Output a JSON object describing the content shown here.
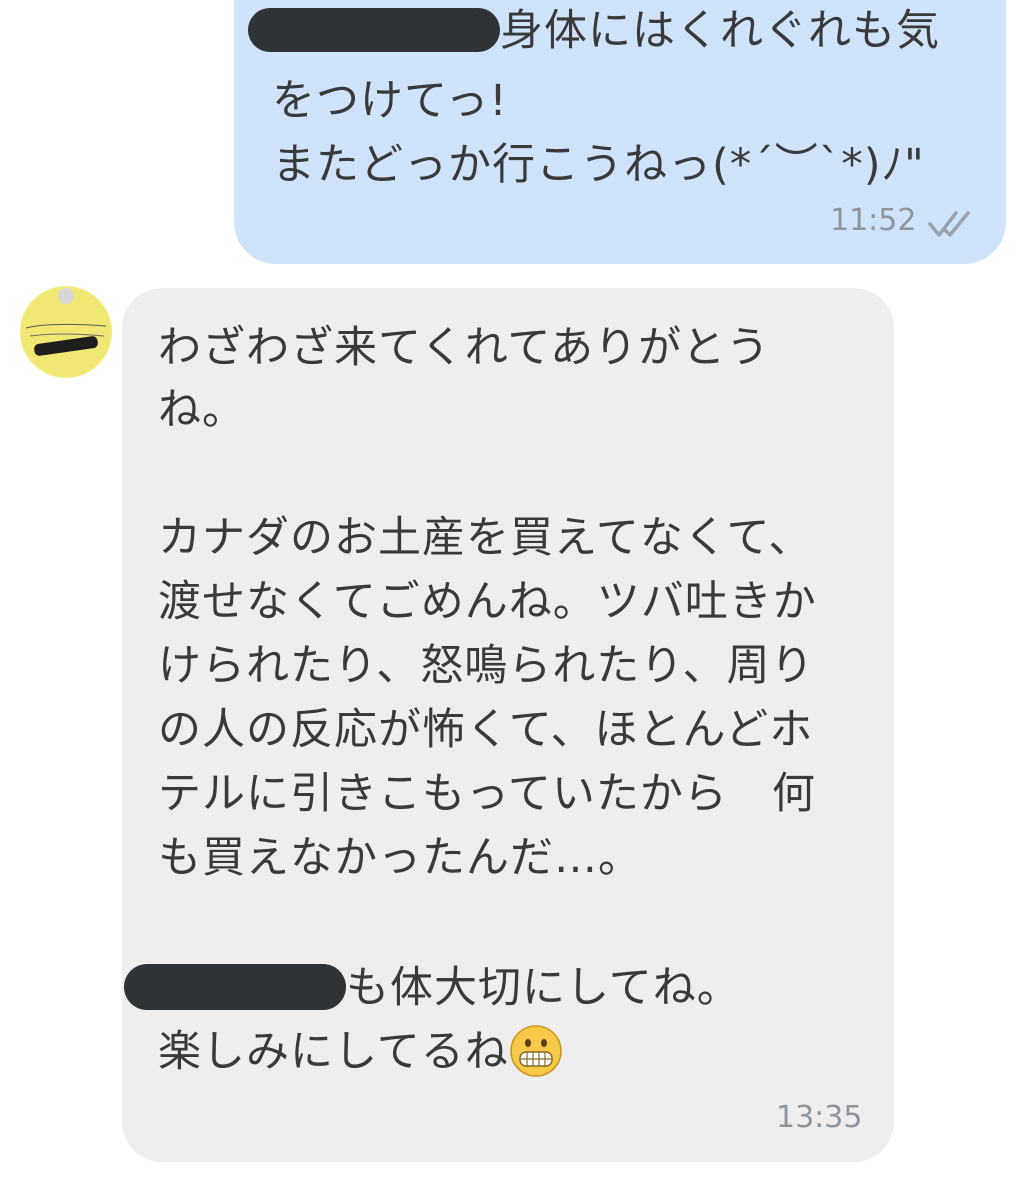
{
  "outgoing": {
    "line1_text": "身体にはくれぐれも気",
    "line2": "をつけてっ!",
    "line3": "またどっか行こうねっ(*´︶`*)ﾉ\"",
    "time": "11:52",
    "read_icon": "double-check-icon"
  },
  "incoming": {
    "avatar_icon": "avatar-photo-icon",
    "lines": [
      "わざわざ来てくれてありがとう",
      "ね。",
      "カナダのお土産を買えてなくて、",
      "渡せなくてごめんね。ツバ吐きか",
      "けられたり、怒鳴られたり、周り",
      "の人の反応が怖くて、ほとんどホ",
      "テルに引きこもっていたから　何",
      "も買えなかったんだ…。"
    ],
    "line_after_redact": "も体大切にしてね。",
    "last_line_text": "楽しみにしてるね",
    "emoji_icon": "grimacing-face-emoji-icon",
    "time": "13:35"
  },
  "colors": {
    "outgoing_bubble": "#cfe3fb",
    "incoming_bubble": "#eeeeee",
    "text": "#3a3a3a",
    "timestamp": "#8f959c",
    "redaction": "#2f3337"
  }
}
